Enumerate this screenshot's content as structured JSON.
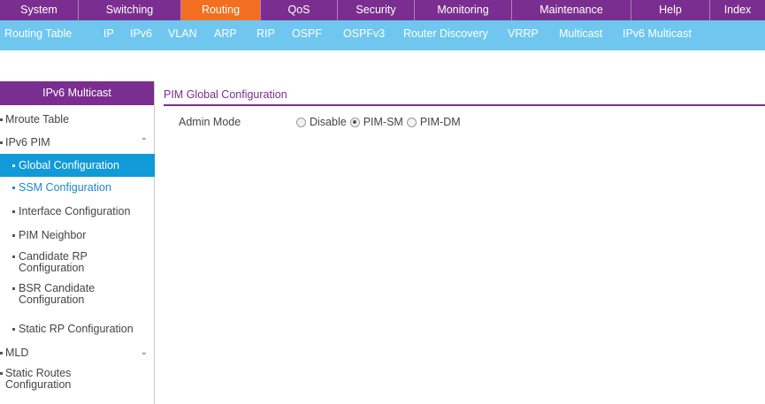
{
  "topnav": {
    "tabs": [
      {
        "label": "System"
      },
      {
        "label": "Switching"
      },
      {
        "label": "Routing"
      },
      {
        "label": "QoS"
      },
      {
        "label": "Security"
      },
      {
        "label": "Monitoring"
      },
      {
        "label": "Maintenance"
      },
      {
        "label": "Help"
      },
      {
        "label": "Index"
      }
    ],
    "active": "Routing"
  },
  "subnav": {
    "items": [
      {
        "label": "Routing Table"
      },
      {
        "label": "IP"
      },
      {
        "label": "IPv6"
      },
      {
        "label": "VLAN"
      },
      {
        "label": "ARP"
      },
      {
        "label": "RIP"
      },
      {
        "label": "OSPF"
      },
      {
        "label": "OSPFv3"
      },
      {
        "label": "Router Discovery"
      },
      {
        "label": "VRRP"
      },
      {
        "label": "Multicast"
      },
      {
        "label": "IPv6 Multicast"
      }
    ],
    "active": "IPv6 Multicast"
  },
  "sidebar": {
    "header": "IPv6 Multicast",
    "items": [
      {
        "label": "Mroute Table"
      },
      {
        "label": "IPv6 PIM",
        "caret": "^"
      },
      {
        "label": "Global Configuration"
      },
      {
        "label": "SSM Configuration"
      },
      {
        "label": "Interface Configuration"
      },
      {
        "label": "PIM Neighbor"
      },
      {
        "label": "Candidate RP",
        "label2": "Configuration"
      },
      {
        "label": "BSR Candidate",
        "label2": "Configuration"
      },
      {
        "label": "Static RP Configuration"
      },
      {
        "label": "MLD",
        "caret": "v"
      },
      {
        "label": "Static Routes",
        "label2": "Configuration"
      }
    ]
  },
  "content": {
    "section_title": "PIM Global Configuration",
    "admin_mode": {
      "label": "Admin Mode",
      "options": [
        "Disable",
        "PIM-SM",
        "PIM-DM"
      ],
      "selected": "PIM-SM"
    }
  },
  "colors": {
    "brand_purple": "#7a2e8f",
    "active_orange": "#f26f21",
    "subnav_blue": "#6fc7ef",
    "selected_blue": "#109ad7",
    "link_blue": "#1b88c8"
  }
}
